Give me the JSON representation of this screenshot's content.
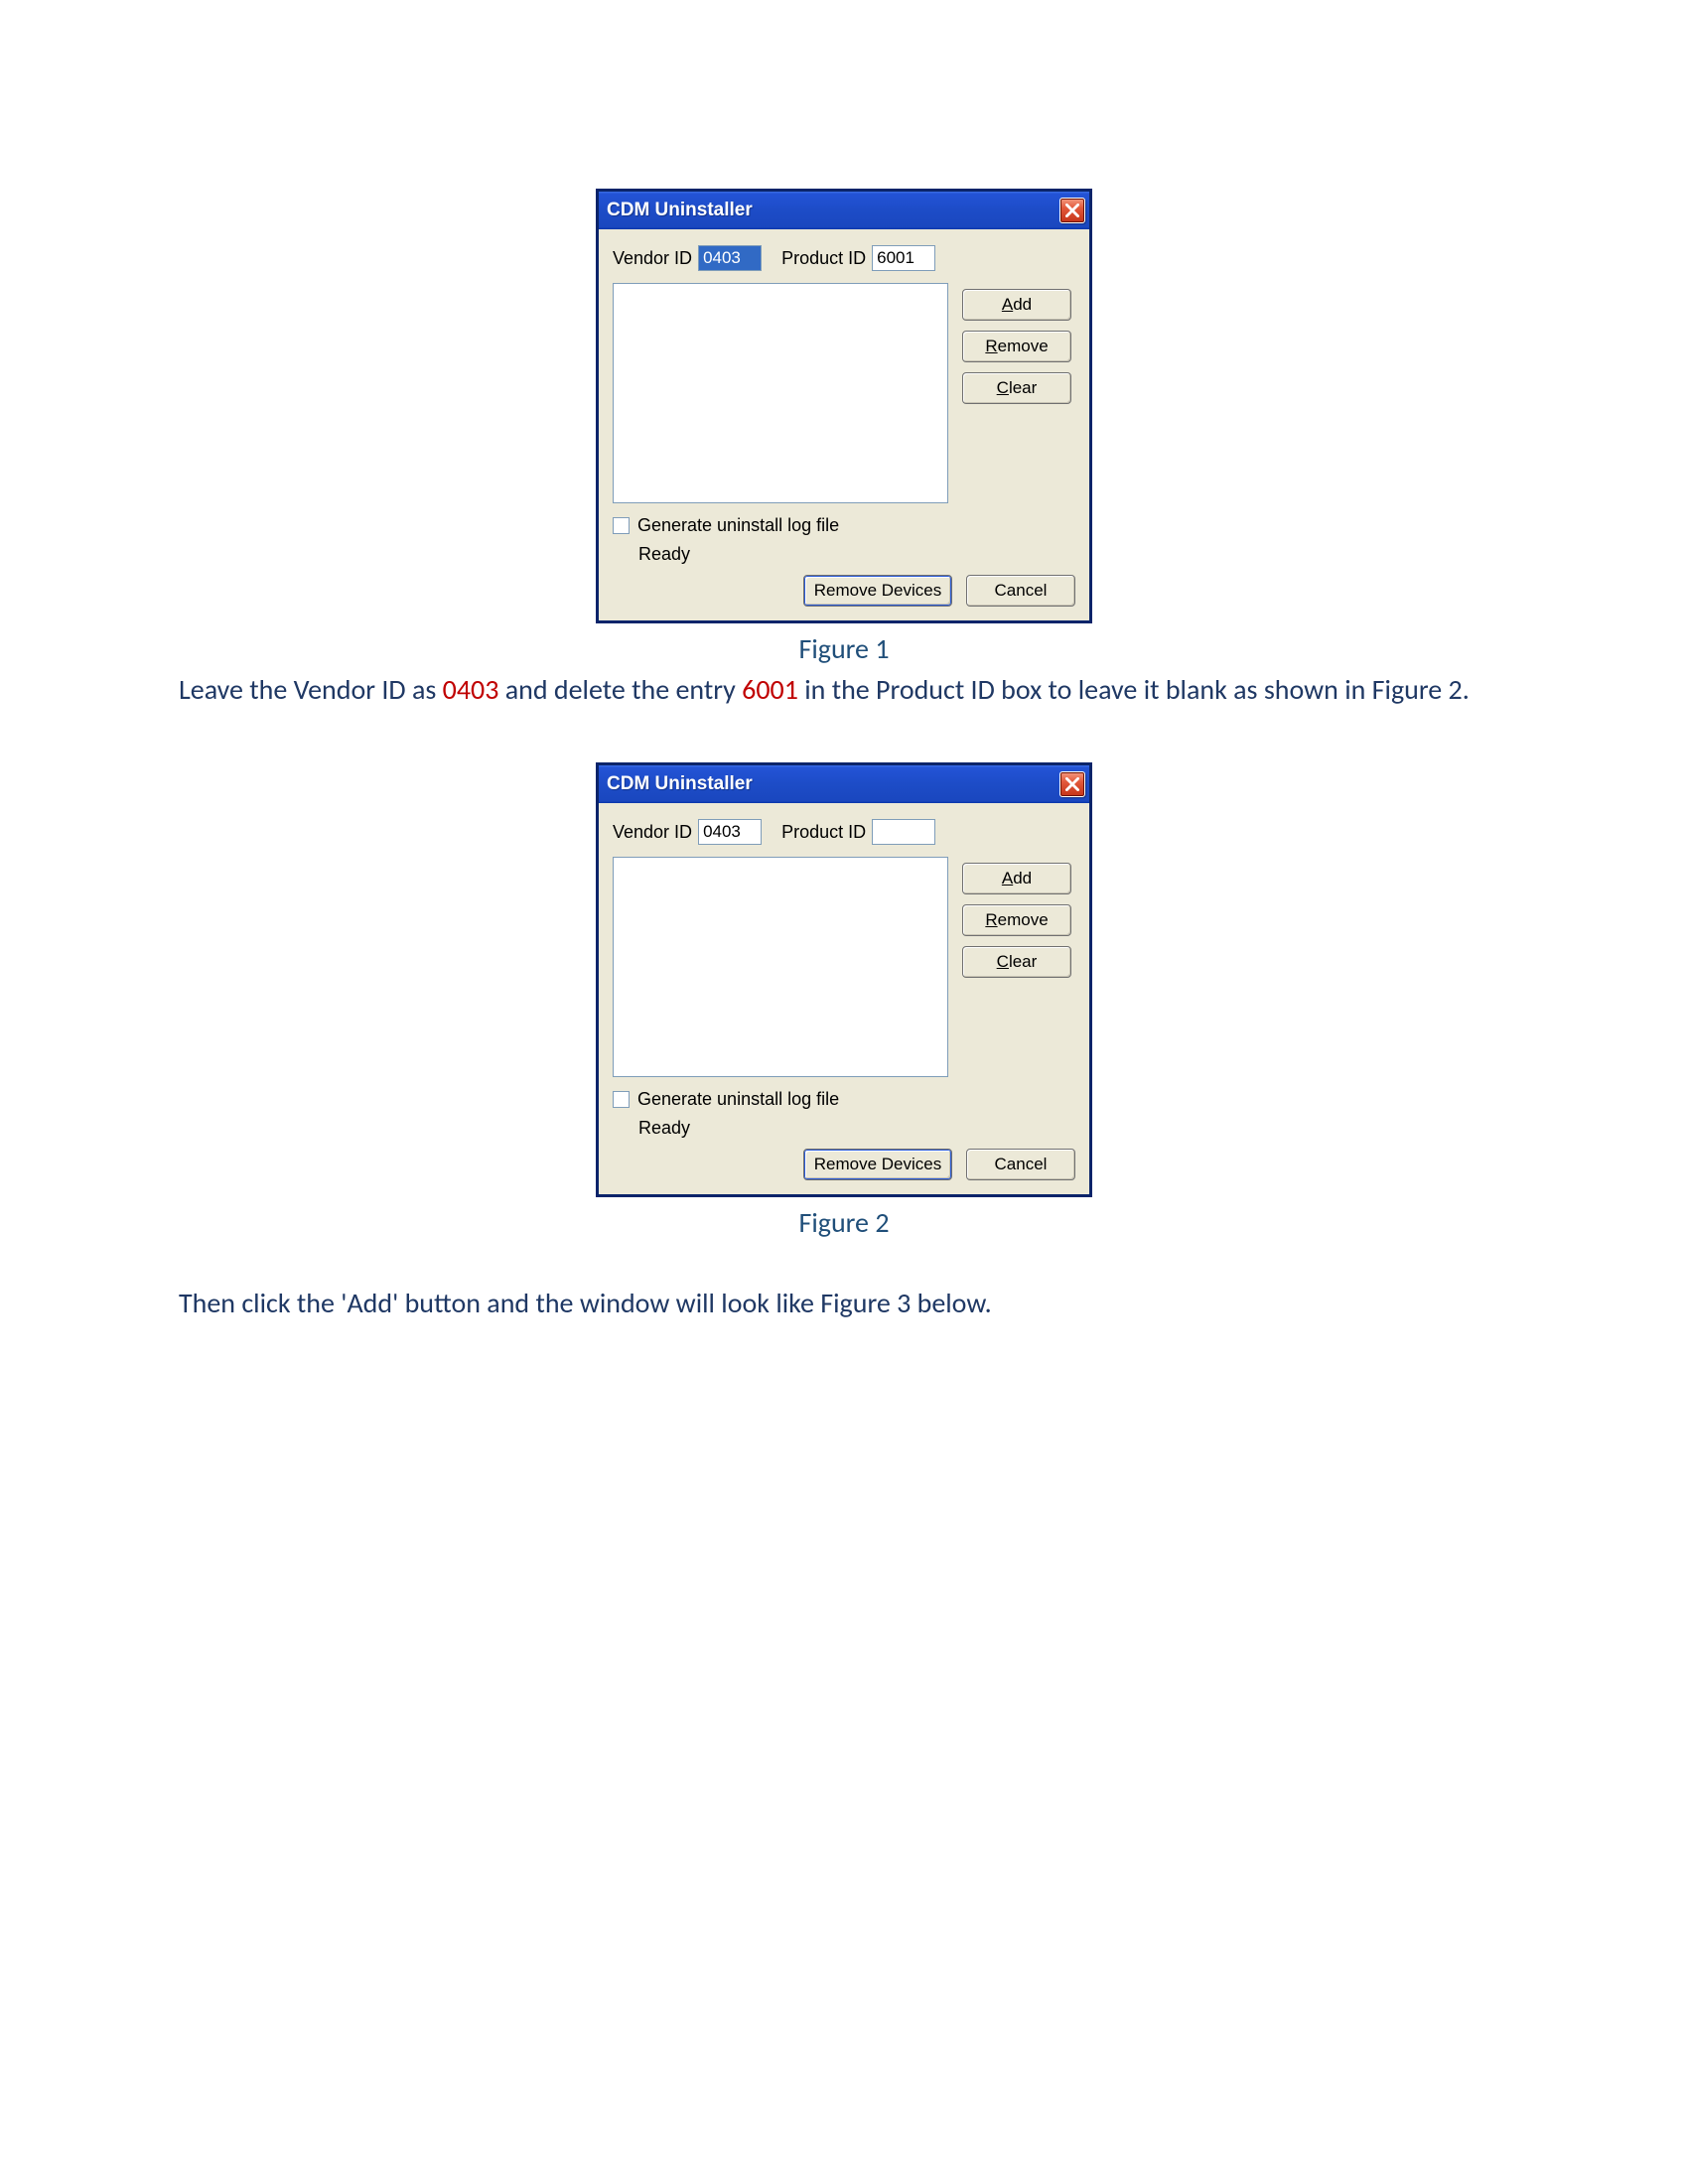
{
  "dialog": {
    "title": "CDM Uninstaller",
    "vendor_label": "Vendor ID",
    "product_label": "Product ID",
    "btn_add_u": "A",
    "btn_add_rest": "dd",
    "btn_remove_u": "R",
    "btn_remove_rest": "emove",
    "btn_clear_u": "C",
    "btn_clear_rest": "lear",
    "checkbox_label": "Generate uninstall log file",
    "status": "Ready",
    "btn_remove_devices": "Remove Devices",
    "btn_cancel": "Cancel"
  },
  "fig1": {
    "vendor_value": "0403",
    "product_value": "6001",
    "caption": "Figure 1"
  },
  "fig2": {
    "vendor_value": "0403",
    "product_value": "",
    "caption": "Figure 2"
  },
  "para1": {
    "t1": "Leave the Vendor ID as ",
    "v1": "0403",
    "t2": " and delete the entry ",
    "v2": "6001",
    "t3": " in the Product ID box to leave it blank as shown in Figure 2."
  },
  "para2": "Then click the 'Add' button and the window will look like Figure 3 below."
}
